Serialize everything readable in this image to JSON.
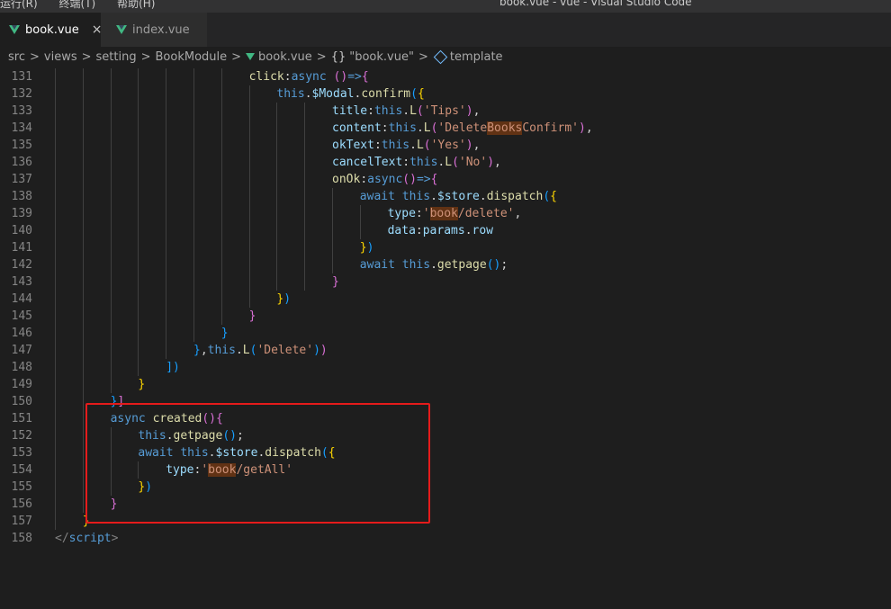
{
  "titlebar": {
    "menus": [
      "运行(R)",
      "终端(T)",
      "帮助(H)"
    ],
    "window_title": "book.vue - vue - Visual Studio Code"
  },
  "tabs": [
    {
      "label": "book.vue",
      "active": true,
      "close": "×"
    },
    {
      "label": "index.vue",
      "active": false
    }
  ],
  "breadcrumb": {
    "items": [
      "src",
      "views",
      "setting",
      "BookModule",
      "book.vue",
      "\"book.vue\"",
      "template"
    ],
    "separator": ">",
    "braces_glyph": "{}"
  },
  "colors": {
    "highlight_box": "#e51b1b",
    "editor_bg": "#1e1e1e"
  },
  "lines": [
    {
      "n": "131",
      "indent": 7,
      "tokens": [
        [
          "f",
          "click"
        ],
        [
          "t",
          ":"
        ],
        [
          "k",
          "async "
        ],
        [
          "b2",
          "()"
        ],
        [
          "k",
          "=>"
        ],
        [
          "b2",
          "{"
        ]
      ]
    },
    {
      "n": "132",
      "indent": 8,
      "tokens": [
        [
          "k",
          "this"
        ],
        [
          "t",
          "."
        ],
        [
          "p",
          "$Modal"
        ],
        [
          "t",
          "."
        ],
        [
          "f",
          "confirm"
        ],
        [
          "b3",
          "("
        ],
        [
          "b1",
          "{"
        ]
      ]
    },
    {
      "n": "133",
      "indent": 10,
      "tokens": [
        [
          "p",
          "title"
        ],
        [
          "t",
          ":"
        ],
        [
          "k",
          "this"
        ],
        [
          "t",
          "."
        ],
        [
          "f",
          "L"
        ],
        [
          "b2",
          "("
        ],
        [
          "s",
          "'Tips'"
        ],
        [
          "b2",
          ")"
        ],
        [
          "t",
          ","
        ]
      ]
    },
    {
      "n": "134",
      "indent": 10,
      "tokens": [
        [
          "p",
          "content"
        ],
        [
          "t",
          ":"
        ],
        [
          "k",
          "this"
        ],
        [
          "t",
          "."
        ],
        [
          "f",
          "L"
        ],
        [
          "b2",
          "("
        ],
        [
          "s",
          "'Delete"
        ],
        [
          "shl",
          "Books"
        ],
        [
          "s",
          "Confirm'"
        ],
        [
          "b2",
          ")"
        ],
        [
          "t",
          ","
        ]
      ]
    },
    {
      "n": "135",
      "indent": 10,
      "tokens": [
        [
          "p",
          "okText"
        ],
        [
          "t",
          ":"
        ],
        [
          "k",
          "this"
        ],
        [
          "t",
          "."
        ],
        [
          "f",
          "L"
        ],
        [
          "b2",
          "("
        ],
        [
          "s",
          "'Yes'"
        ],
        [
          "b2",
          ")"
        ],
        [
          "t",
          ","
        ]
      ]
    },
    {
      "n": "136",
      "indent": 10,
      "tokens": [
        [
          "p",
          "cancelText"
        ],
        [
          "t",
          ":"
        ],
        [
          "k",
          "this"
        ],
        [
          "t",
          "."
        ],
        [
          "f",
          "L"
        ],
        [
          "b2",
          "("
        ],
        [
          "s",
          "'No'"
        ],
        [
          "b2",
          ")"
        ],
        [
          "t",
          ","
        ]
      ]
    },
    {
      "n": "137",
      "indent": 10,
      "tokens": [
        [
          "f",
          "onOk"
        ],
        [
          "t",
          ":"
        ],
        [
          "k",
          "async"
        ],
        [
          "b2",
          "()"
        ],
        [
          "k",
          "=>"
        ],
        [
          "b2",
          "{"
        ]
      ]
    },
    {
      "n": "138",
      "indent": 11,
      "tokens": [
        [
          "k",
          "await "
        ],
        [
          "k",
          "this"
        ],
        [
          "t",
          "."
        ],
        [
          "p",
          "$store"
        ],
        [
          "t",
          "."
        ],
        [
          "f",
          "dispatch"
        ],
        [
          "b3",
          "("
        ],
        [
          "b1",
          "{"
        ]
      ]
    },
    {
      "n": "139",
      "indent": 12,
      "tokens": [
        [
          "p",
          "type"
        ],
        [
          "t",
          ":"
        ],
        [
          "s",
          "'"
        ],
        [
          "shl",
          "book"
        ],
        [
          "s",
          "/delete'"
        ],
        [
          "t",
          ","
        ]
      ]
    },
    {
      "n": "140",
      "indent": 12,
      "tokens": [
        [
          "p",
          "data"
        ],
        [
          "t",
          ":"
        ],
        [
          "p",
          "params"
        ],
        [
          "t",
          "."
        ],
        [
          "p",
          "row"
        ]
      ]
    },
    {
      "n": "141",
      "indent": 11,
      "tokens": [
        [
          "b1",
          "}"
        ],
        [
          "b3",
          ")"
        ]
      ]
    },
    {
      "n": "142",
      "indent": 11,
      "tokens": [
        [
          "k",
          "await "
        ],
        [
          "k",
          "this"
        ],
        [
          "t",
          "."
        ],
        [
          "f",
          "getpage"
        ],
        [
          "b3",
          "()"
        ],
        [
          "t",
          ";"
        ]
      ]
    },
    {
      "n": "143",
      "indent": 10,
      "tokens": [
        [
          "b2",
          "}"
        ]
      ]
    },
    {
      "n": "144",
      "indent": 8,
      "tokens": [
        [
          "b1",
          "}"
        ],
        [
          "b3",
          ")"
        ]
      ]
    },
    {
      "n": "145",
      "indent": 7,
      "tokens": [
        [
          "b2",
          "}"
        ]
      ]
    },
    {
      "n": "146",
      "indent": 6,
      "tokens": [
        [
          "b3",
          "}"
        ]
      ]
    },
    {
      "n": "147",
      "indent": 5,
      "tokens": [
        [
          "b3",
          "}"
        ],
        [
          "t",
          ","
        ],
        [
          "k",
          "this"
        ],
        [
          "t",
          "."
        ],
        [
          "f",
          "L"
        ],
        [
          "b3",
          "("
        ],
        [
          "s",
          "'Delete'"
        ],
        [
          "b3",
          ")"
        ],
        [
          "b2",
          ")"
        ]
      ]
    },
    {
      "n": "148",
      "indent": 4,
      "tokens": [
        [
          "b3",
          "])"
        ]
      ]
    },
    {
      "n": "149",
      "indent": 3,
      "tokens": [
        [
          "b1",
          "}"
        ]
      ]
    },
    {
      "n": "150",
      "indent": 2,
      "tokens": [
        [
          "b3",
          "}"
        ],
        [
          "b2",
          "]"
        ]
      ]
    },
    {
      "n": "151",
      "indent": 2,
      "tokens": [
        [
          "k",
          "async "
        ],
        [
          "f",
          "created"
        ],
        [
          "b2",
          "()"
        ],
        [
          "b2",
          "{"
        ]
      ]
    },
    {
      "n": "152",
      "indent": 3,
      "tokens": [
        [
          "k",
          "this"
        ],
        [
          "t",
          "."
        ],
        [
          "f",
          "getpage"
        ],
        [
          "b3",
          "()"
        ],
        [
          "t",
          ";"
        ]
      ]
    },
    {
      "n": "153",
      "indent": 3,
      "tokens": [
        [
          "k",
          "await "
        ],
        [
          "k",
          "this"
        ],
        [
          "t",
          "."
        ],
        [
          "p",
          "$store"
        ],
        [
          "t",
          "."
        ],
        [
          "f",
          "dispatch"
        ],
        [
          "b3",
          "("
        ],
        [
          "b1",
          "{"
        ]
      ]
    },
    {
      "n": "154",
      "indent": 4,
      "tokens": [
        [
          "p",
          "type"
        ],
        [
          "t",
          ":"
        ],
        [
          "s",
          "'"
        ],
        [
          "shl",
          "book"
        ],
        [
          "s",
          "/getAll'"
        ]
      ]
    },
    {
      "n": "155",
      "indent": 3,
      "tokens": [
        [
          "b1",
          "}"
        ],
        [
          "b3",
          ")"
        ]
      ]
    },
    {
      "n": "156",
      "indent": 2,
      "tokens": [
        [
          "b2",
          "}"
        ]
      ]
    },
    {
      "n": "157",
      "indent": 1,
      "tokens": [
        [
          "b1",
          "}"
        ]
      ]
    },
    {
      "n": "158",
      "indent": 0,
      "tokens": [
        [
          "tg",
          "</"
        ],
        [
          "tgn",
          "script"
        ],
        [
          "tg",
          ">"
        ]
      ]
    }
  ]
}
